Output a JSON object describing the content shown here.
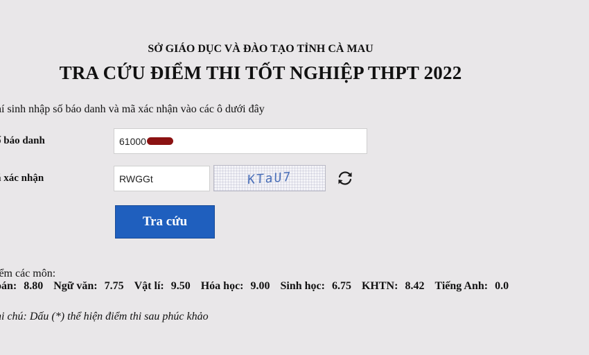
{
  "header": {
    "department": "SỞ GIÁO DỤC VÀ ĐÀO TẠO TỈNH CÀ MAU",
    "title": "TRA CỨU ĐIỂM THI TỐT NGHIỆP THPT 2022"
  },
  "form": {
    "instruction": "hí sinh nhập số báo danh và mã xác nhận vào các ô dưới đây",
    "sbd_label": "ố báo danh",
    "sbd_value": "61000",
    "captcha_label": "ã xác nhận",
    "captcha_value": "RWGGt",
    "captcha_image_text": "KTaU7",
    "submit_label": "Tra cứu",
    "redaction_color": "#8b1212",
    "button_color": "#1f5fbe"
  },
  "results": {
    "heading": "iểm các môn:",
    "scores": [
      {
        "subject": "oán:",
        "value": "8.80"
      },
      {
        "subject": "Ngữ văn:",
        "value": "7.75"
      },
      {
        "subject": "Vật lí:",
        "value": "9.50"
      },
      {
        "subject": "Hóa học:",
        "value": "9.00"
      },
      {
        "subject": "Sinh học:",
        "value": "6.75"
      },
      {
        "subject": "KHTN:",
        "value": "8.42"
      },
      {
        "subject": "Tiếng Anh:",
        "value": "0.0"
      }
    ],
    "note": "hi chú: Dấu (*) thể hiện điểm thi sau phúc khảo"
  },
  "icons": {
    "refresh": "refresh-icon"
  }
}
